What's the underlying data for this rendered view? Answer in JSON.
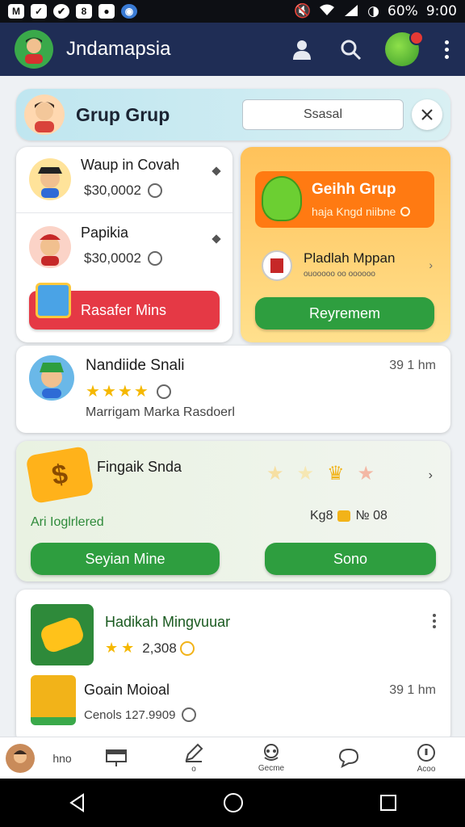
{
  "status_bar": {
    "battery": "60%",
    "time": "9:00"
  },
  "app_bar": {
    "title": "Jndamapsia"
  },
  "group_header": {
    "title": "Grup Grup",
    "search_value": "Ssasal"
  },
  "left_card": {
    "items": [
      {
        "name": "Waup in Covah",
        "price": "$30,0002"
      },
      {
        "name": "Papikia",
        "price": "$30,0002"
      }
    ],
    "button_label": "Rasafer Mins"
  },
  "right_card": {
    "top_title": "Geihh Grup",
    "top_subtitle": "haja Kngd niibne",
    "mid_title": "Pladlah Mppan",
    "mid_subtitle": "ouooooo oo oooooo",
    "button_label": "Reyremem"
  },
  "profile_card": {
    "name": "Nandiide Snali",
    "time": "39 1 hm",
    "rating": 4,
    "description": "Marrigam Marka Rasdoerl"
  },
  "reward_card": {
    "title": "Fingaik Snda",
    "subtitle": "Ari Ioglrlered",
    "count": "Kg8",
    "count_value": "№ 08",
    "button_left": "Seyian Mine",
    "button_right": "Sono"
  },
  "list_card": {
    "item1_title": "Hadikah Mingvuuar",
    "item1_rating": 2,
    "item1_value": "2,308",
    "item2_title": "Goain Moioal",
    "item2_time": "39 1 hm",
    "item2_sub": "Cenols 127.9909"
  },
  "bottom_nav": {
    "items": [
      {
        "label": "hno",
        "icon": "profile-icon"
      },
      {
        "label": "",
        "icon": "storefront-icon"
      },
      {
        "label": "o",
        "icon": "edit-icon"
      },
      {
        "label": "Gecme",
        "icon": "game-icon"
      },
      {
        "label": "",
        "icon": "chat-icon"
      },
      {
        "label": "Acoo",
        "icon": "info-icon"
      }
    ]
  },
  "colors": {
    "app_bar": "#1f2d55",
    "accent_green": "#2e9e3f",
    "accent_red": "#e53945",
    "accent_orange": "#ff7a12"
  }
}
